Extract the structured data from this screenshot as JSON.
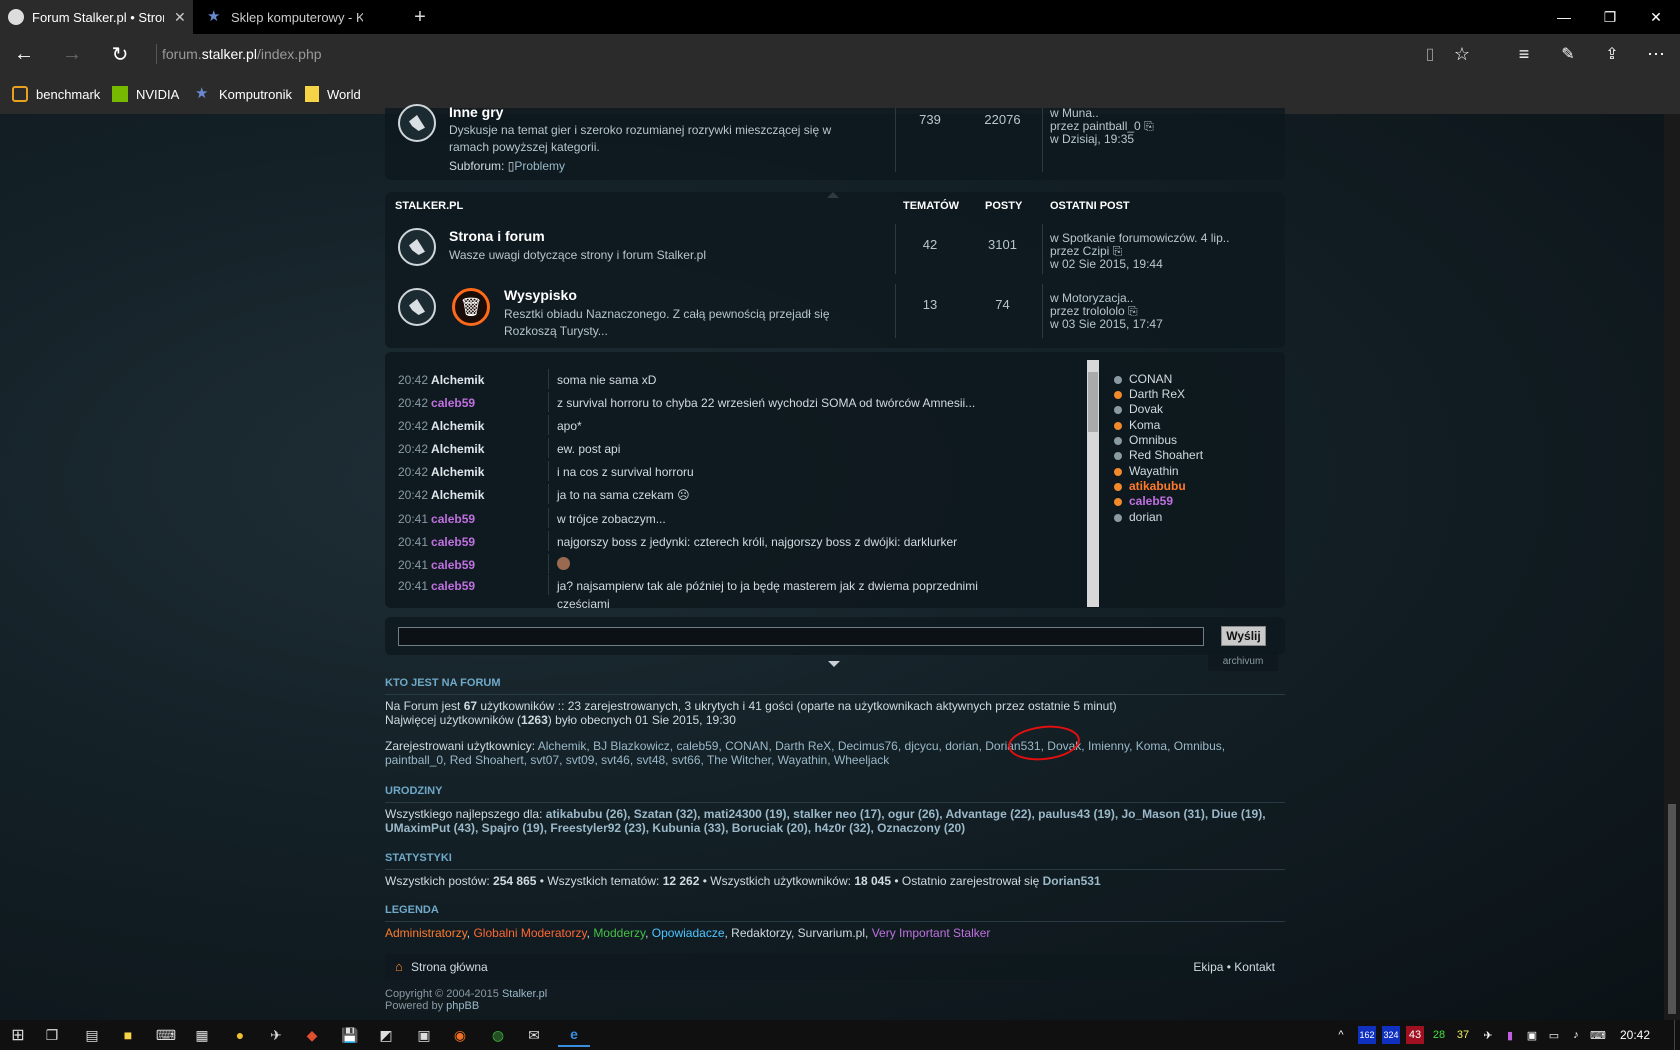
{
  "browser": {
    "tabs": [
      {
        "title": "Forum Stalker.pl • Strona",
        "active": true
      },
      {
        "title": "Sklep komputerowy - Kompu",
        "active": false
      }
    ],
    "url_prefix": "forum.",
    "url_domain": "stalker.pl",
    "url_path": "/index.php",
    "favorites": [
      "benchmark",
      "NVIDIA",
      "Komputronik",
      "World"
    ]
  },
  "forum_top": {
    "title": "Inne gry",
    "desc": "Dyskusje na temat gier i szeroko rozumianej rozrywki mieszczącej się w ramach powyższej kategorii.",
    "subforum_label": "Subforum:",
    "subforum_link": "Problemy",
    "topics": "739",
    "posts": "22076",
    "last_line1": "w Muna..",
    "last_line2": "przez paintball_0",
    "last_line3": "w Dzisiaj, 19:35"
  },
  "category": {
    "name": "STALKER.PL",
    "col_topics": "TEMATÓW",
    "col_posts": "POSTY",
    "col_last": "OSTATNI POST",
    "forums": [
      {
        "title": "Strona i forum",
        "desc": "Wasze uwagi dotyczące strony i forum Stalker.pl",
        "topics": "42",
        "posts": "3101",
        "last1": "w Spotkanie forumowiczów. 4 lip..",
        "last2": "przez Czipi",
        "last3": "w 02 Sie 2015, 19:44"
      },
      {
        "title": "Wysypisko",
        "desc": "Resztki obiadu Naznaczonego. Z całą pewnością przejadł się Rozkoszą Turysty...",
        "topics": "13",
        "posts": "74",
        "last1": "w Motoryzacja..",
        "last2": "przez trolololo",
        "last3": "w 03 Sie 2015, 17:47"
      }
    ]
  },
  "chat": {
    "messages": [
      {
        "time": "20:42",
        "user": "Alchemik",
        "text": "soma nie sama xD"
      },
      {
        "time": "20:42",
        "user": "caleb59",
        "text": "z survival horroru to chyba 22 wrzesień wychodzi SOMA od twórców Amnesii..."
      },
      {
        "time": "20:42",
        "user": "Alchemik",
        "text": "apo*"
      },
      {
        "time": "20:42",
        "user": "Alchemik",
        "text": "ew. post api"
      },
      {
        "time": "20:42",
        "user": "Alchemik",
        "text": "i na cos z survival horroru"
      },
      {
        "time": "20:42",
        "user": "Alchemik",
        "text": "ja to na sama czekam"
      },
      {
        "time": "20:41",
        "user": "caleb59",
        "text": "w trójce zobaczym..."
      },
      {
        "time": "20:41",
        "user": "caleb59",
        "text": "najgorszy boss z jedynki: czterech króli, najgorszy boss z dwójki: darklurker"
      },
      {
        "time": "20:41",
        "user": "caleb59",
        "text": ""
      },
      {
        "time": "20:41",
        "user": "caleb59",
        "text": "ja? najsampierw tak ale później to ja będę masterem jak z dwiema poprzednimi"
      },
      {
        "time": "",
        "user": "",
        "text": "cześciami"
      }
    ],
    "online": [
      "CONAN",
      "Darth ReX",
      "Dovak",
      "Koma",
      "Omnibus",
      "Red Shoahert",
      "Wayathin",
      "atikabubu",
      "caleb59",
      "dorian"
    ],
    "send_label": "Wyślij",
    "archive_label": "archivum"
  },
  "who": {
    "heading": "KTO JEST NA FORUM",
    "line1_a": "Na Forum jest ",
    "line1_b": "67",
    "line1_c": " użytkowników :: 23 zarejestrowanych, 3 ukrytych i 41 gości (oparte na użytkownikach aktywnych przez ostatnie 5 minut)",
    "line2_a": "Najwięcej użytkowników (",
    "line2_b": "1263",
    "line2_c": ") było obecnych 01 Sie 2015, 19:30",
    "registered_label": "Zarejestrowani użytkownicy:",
    "registered_users": "Alchemik, BJ Blazkowicz, caleb59, CONAN, Darth ReX, Decimus76, djcycu, dorian, Dorian531, Dovak, Imienny, Koma, Omnibus, paintball_0, Red Shoahert, svt07, svt09, svt46, svt48, svt66, The Witcher, Wayathin, Wheeljack"
  },
  "birthdays": {
    "heading": "URODZINY",
    "label": "Wszystkiego najlepszego dla:",
    "list": "atikabubu (26), Szatan (32), mati24300 (19), stalker neo (17), ogur (26), Advantage (22), paulus43 (19), Jo_Mason (31), Diue (19), UMaximPut (43), Spajro (19), Freestyler92 (23), Kubunia (33), Boruciak (20), h4z0r (32), Oznaczony (20)"
  },
  "stats": {
    "heading": "STATYSTYKI",
    "posts_label": "Wszystkich postów:",
    "posts": "254 865",
    "topics_label": "Wszystkich tematów:",
    "topics": "12 262",
    "users_label": "Wszystkich użytkowników:",
    "users": "18 045",
    "newest_label": "Ostatnio zarejestrował się",
    "newest": "Dorian531"
  },
  "legend": {
    "heading": "LEGENDA",
    "items": [
      {
        "name": "Administratorzy",
        "color": "#ff7a2a"
      },
      {
        "name": "Globalni Moderatorzy",
        "color": "#ff6633"
      },
      {
        "name": "Modderzy",
        "color": "#45c045"
      },
      {
        "name": "Opowiadacze",
        "color": "#4fc4ff"
      },
      {
        "name": "Redaktorzy",
        "color": "#d0dadf"
      },
      {
        "name": "Survarium.pl",
        "color": "#d0dadf"
      },
      {
        "name": "Very Important Stalker",
        "color": "#c070e0"
      }
    ]
  },
  "footer": {
    "home": "Strona główna",
    "links": "Ekipa • Kontakt",
    "copyright_a": "Copyright © 2004-2015 ",
    "copyright_b": "Stalker.pl",
    "powered_a": "Powered by ",
    "powered_b": "phpBB"
  },
  "taskbar": {
    "time": "20:42",
    "tray": [
      "162",
      "324",
      "43",
      "28",
      "37"
    ]
  },
  "colors": {
    "accent_orange": "#ff8a2a",
    "purple_user": "#c070e0",
    "heading_blue": "#6fa8c8"
  }
}
